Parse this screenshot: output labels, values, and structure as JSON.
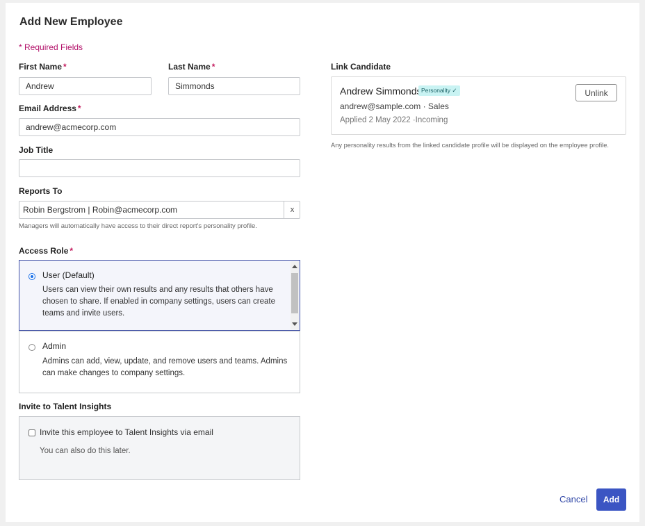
{
  "form": {
    "title": "Add New Employee",
    "required_note": "* Required Fields",
    "required_marker": "*",
    "first_name": {
      "label": "First Name",
      "value": "Andrew"
    },
    "last_name": {
      "label": "Last Name",
      "value": "Simmonds"
    },
    "email": {
      "label": "Email Address",
      "value": "andrew@acmecorp.com"
    },
    "job_title": {
      "label": "Job Title",
      "value": ""
    },
    "reports_to": {
      "label": "Reports To",
      "value": "Robin Bergstrom | Robin@acmecorp.com",
      "clear": "x",
      "hint": "Managers will automatically have access to their direct report's personality profile."
    },
    "access_role": {
      "label": "Access Role",
      "options": [
        {
          "title": "User (Default)",
          "description": "Users can view their own results and any results that others have chosen to share. If enabled in company settings, users can create teams and invite users.",
          "selected": true
        },
        {
          "title": "Admin",
          "description": "Admins can add, view, update, and remove users and teams. Admins can make changes to company settings.",
          "selected": false
        }
      ]
    },
    "invite": {
      "label": "Invite to Talent Insights",
      "checkbox_label": "Invite this employee to Talent Insights via email",
      "checked": false,
      "note": "You can also do this later."
    }
  },
  "link_candidate": {
    "label": "Link Candidate",
    "name": "Andrew Simmonds",
    "badge": "Personality ✓",
    "email": "andrew@sample.com",
    "department": "· Sales",
    "applied": "Applied 2 May 2022 ·Incoming",
    "unlink_label": "Unlink",
    "hint": "Any personality results from the linked candidate profile will be displayed on the employee profile."
  },
  "actions": {
    "cancel_label": "Cancel",
    "add_label": "Add"
  },
  "colors": {
    "primary": "#3b55c3",
    "required": "#c2185b",
    "badge_bg": "#c9f3f3",
    "selected_border": "#3d4ea6"
  }
}
